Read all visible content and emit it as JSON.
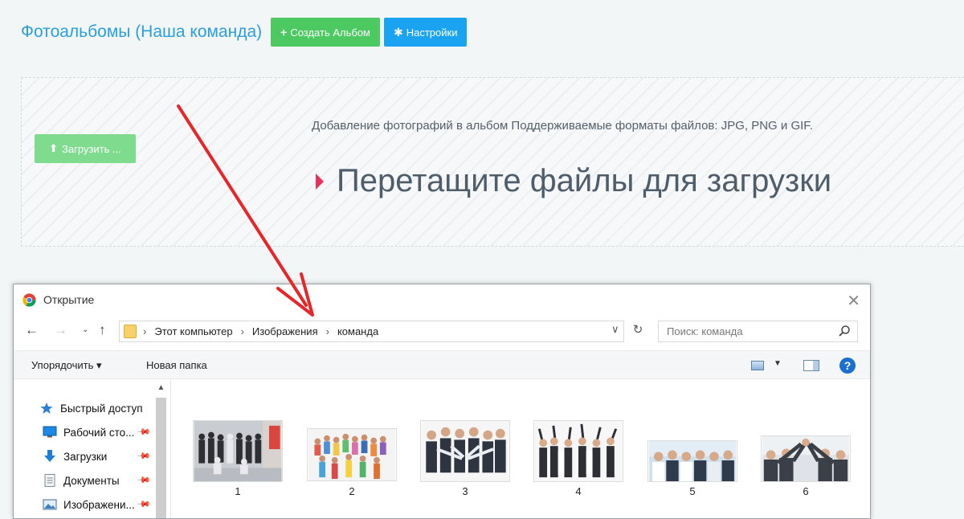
{
  "header": {
    "title": "Фотоальбомы (Наша команда)",
    "create_album_label": "Создать Альбом",
    "settings_label": "Настройки"
  },
  "dropzone": {
    "upload_label": "Загрузить ...",
    "hint": "Добавление фотографий в альбом Поддерживаемые форматы файлов: JPG, PNG и GIF.",
    "drop_title": "Перетащите файлы для загрузки"
  },
  "dialog": {
    "title": "Открытие",
    "breadcrumb": [
      "Этот компьютер",
      "Изображения",
      "команда"
    ],
    "search_placeholder": "Поиск: команда",
    "toolbar": {
      "organize": "Упорядочить ▾",
      "new_folder": "Новая папка"
    },
    "nav_items": [
      {
        "label": "Быстрый доступ",
        "icon": "star-icon",
        "pinned": false
      },
      {
        "label": "Рабочий сто...",
        "icon": "desktop-icon",
        "pinned": true
      },
      {
        "label": "Загрузки",
        "icon": "download-icon",
        "pinned": true
      },
      {
        "label": "Документы",
        "icon": "documents-icon",
        "pinned": true
      },
      {
        "label": "Изображени...",
        "icon": "pictures-icon",
        "pinned": true
      }
    ],
    "files": [
      "1",
      "2",
      "3",
      "4",
      "5",
      "6"
    ]
  },
  "colors": {
    "title_blue": "#2b9fdb",
    "green_button": "#4cc960",
    "blue_button": "#1aa3f0",
    "arrow_red": "#e8262a",
    "caret_pink": "#e8325a"
  }
}
